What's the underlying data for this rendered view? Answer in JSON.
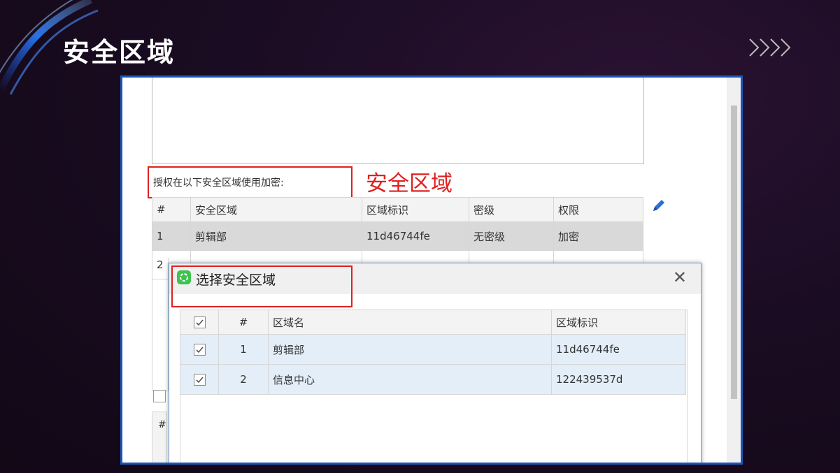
{
  "slide": {
    "title": "安全区域"
  },
  "panel": {
    "auth_label": "授权在以下安全区域使用加密:",
    "annotation": "安全区域",
    "zone_table": {
      "headers": [
        "#",
        "安全区域",
        "区域标识",
        "密级",
        "权限"
      ],
      "rows": [
        [
          "1",
          "剪辑部",
          "11d46744fe",
          "无密级",
          "加密"
        ],
        [
          "2",
          "",
          "",
          "",
          ""
        ]
      ]
    },
    "second_table_header": "#"
  },
  "dialog": {
    "title": "选择安全区域",
    "close_glyph": "✕",
    "headers": [
      "",
      "#",
      "区域名",
      "区域标识"
    ],
    "rows": [
      {
        "checked": true,
        "index": "1",
        "name": "剪辑部",
        "id": "11d46744fe"
      },
      {
        "checked": true,
        "index": "2",
        "name": "信息中心",
        "id": "122439537d"
      }
    ]
  },
  "colors": {
    "accent_red": "#e02020",
    "border_blue": "#1e56b5",
    "selected_row": "#e3eef8"
  }
}
